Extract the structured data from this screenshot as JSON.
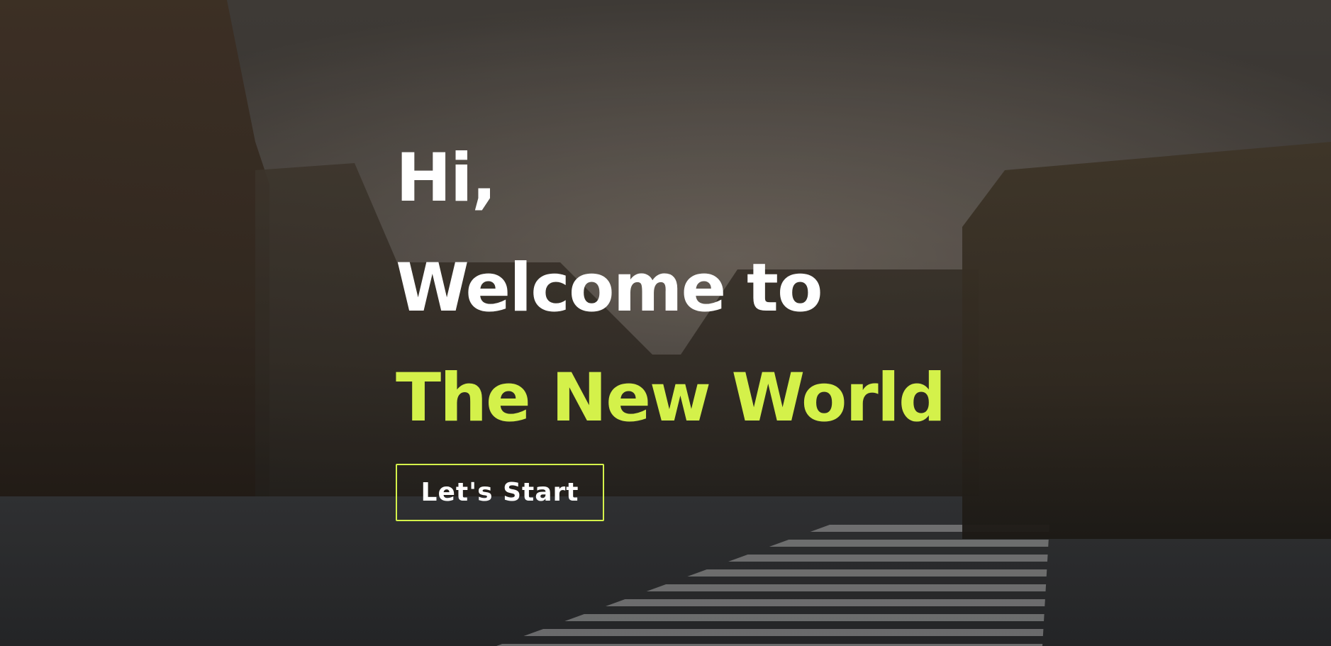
{
  "theme": {
    "accent_color": "#d4f14a",
    "text_color": "#ffffff"
  },
  "hero": {
    "greeting": "Hi,",
    "welcome": "Welcome to",
    "highlight": "The New World",
    "cta_label": "Let's Start"
  }
}
